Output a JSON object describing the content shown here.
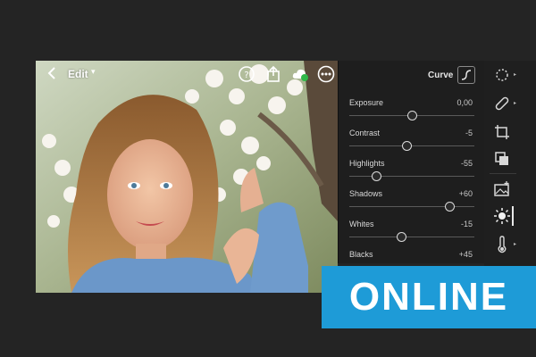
{
  "toolbar": {
    "edit_label": "Edit",
    "icons": [
      "back-icon",
      "help-icon",
      "share-icon",
      "cloud-sync-icon",
      "more-icon"
    ]
  },
  "panel": {
    "header_label": "Curve",
    "sliders": [
      {
        "label": "Exposure",
        "value": "0,00",
        "position": 0.5
      },
      {
        "label": "Contrast",
        "value": "-5",
        "position": 0.46
      },
      {
        "label": "Highlights",
        "value": "-55",
        "position": 0.22
      },
      {
        "label": "Shadows",
        "value": "+60",
        "position": 0.8
      },
      {
        "label": "Whites",
        "value": "-15",
        "position": 0.42
      },
      {
        "label": "Blacks",
        "value": "+45",
        "position": 0.72
      }
    ]
  },
  "rail": {
    "icons": [
      "presets-icon",
      "healing-icon",
      "crop-icon",
      "versions-icon",
      "image-adjust-icon",
      "light-icon",
      "color-temperature-icon"
    ],
    "active": "light-icon"
  },
  "banner": {
    "text": "ONLINE",
    "color": "#1e9bd7"
  },
  "colors": {
    "background": "#242424",
    "panel": "#1e1e1e",
    "accent": "#1e9bd7",
    "cloud_status": "#2fb84a"
  }
}
